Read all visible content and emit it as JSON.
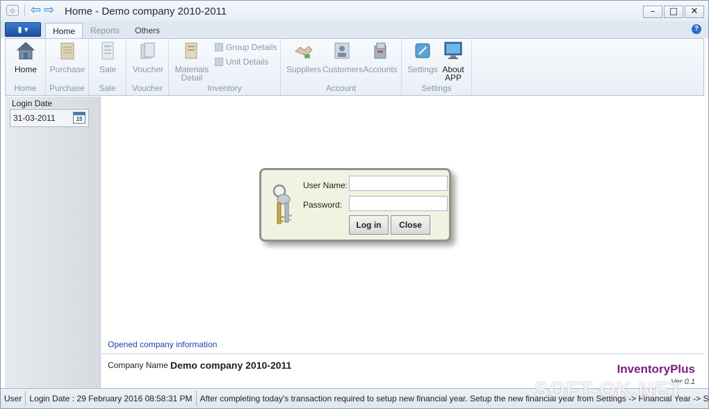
{
  "window": {
    "title": "Home - Demo company 2010-2011",
    "controls": {
      "minimize": "–",
      "maximize": "□",
      "close": "✕"
    }
  },
  "ribbon": {
    "tabs": [
      {
        "label": "Home",
        "state": "active"
      },
      {
        "label": "Reports",
        "state": "disabled"
      },
      {
        "label": "Others",
        "state": "normal"
      }
    ],
    "help": "?",
    "groups": {
      "home": {
        "label": "Home",
        "buttons": {
          "home": "Home"
        }
      },
      "purchase": {
        "label": "Purchase",
        "buttons": {
          "purchase": "Purchase"
        }
      },
      "sale": {
        "label": "Sale",
        "buttons": {
          "sale": "Sale"
        }
      },
      "voucher": {
        "label": "Voucher",
        "buttons": {
          "voucher": "Voucher"
        }
      },
      "inventory": {
        "label": "Inventory",
        "buttons": {
          "materials_detail_1": "Materials",
          "materials_detail_2": "Detail",
          "group_details": "Group Details",
          "unit_details": "Unit Details"
        }
      },
      "account": {
        "label": "Account",
        "buttons": {
          "suppliers": "Suppliers",
          "customers": "Customers",
          "accounts": "Accounts"
        }
      },
      "settings": {
        "label": "Settings",
        "buttons": {
          "settings": "Settings",
          "about_1": "About",
          "about_2": "APP"
        }
      }
    }
  },
  "sidebar": {
    "login_date_label": "Login Date",
    "login_date_value": "31-03-2011",
    "calendar_day": "15"
  },
  "login_dialog": {
    "username_label": "User Name:",
    "username_value": "",
    "password_label": "Password:",
    "password_value": "",
    "login_button": "Log in",
    "close_button": "Close"
  },
  "company_info": {
    "section_title": "Opened company information",
    "company_name_label": "Company Name",
    "company_name": "Demo company 2010-2011",
    "brand": "InventoryPlus",
    "version": "Ver 0.1"
  },
  "status_bar": {
    "user": "User",
    "login_date": "Login Date : 29 February 2016 08:58:31 PM",
    "message": "After completing today's transaction required to setup new financial year. Setup the new financial year from Settings -> Financial Year -> Set New"
  },
  "watermark": "SOFT-OK.NET",
  "colors": {
    "accent": "#2d6cc8",
    "brand": "#7e1b86",
    "link": "#1a3fb0",
    "dialog_bg": "#f2f2e2"
  }
}
